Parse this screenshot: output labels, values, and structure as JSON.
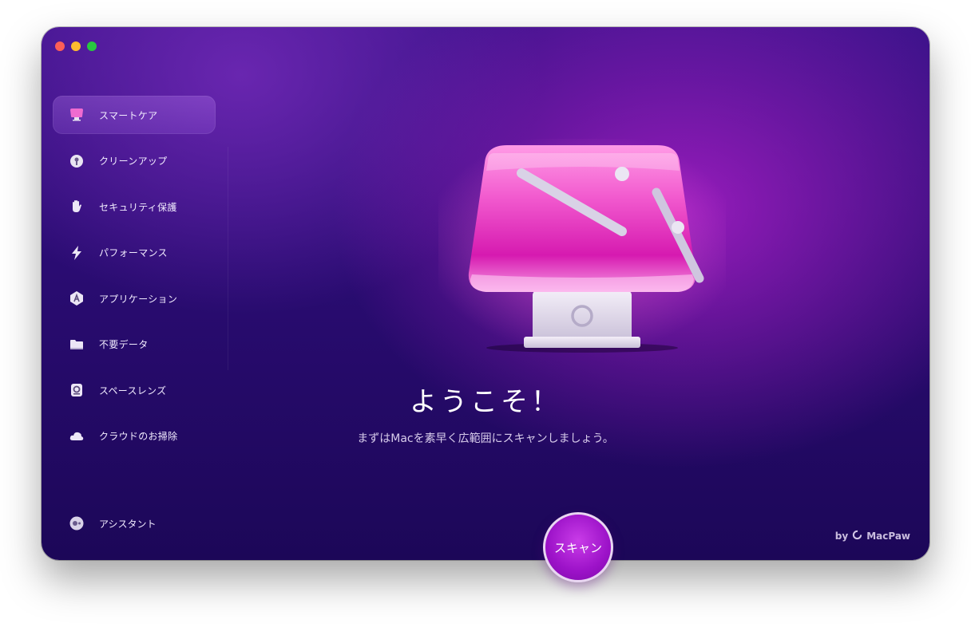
{
  "window": {
    "traffic_lights": [
      "close",
      "minimize",
      "maximize"
    ]
  },
  "sidebar": {
    "items": [
      {
        "label": "スマートケア",
        "icon": "monitor-icon",
        "active": true
      },
      {
        "label": "クリーンアップ",
        "icon": "cleanup-orb-icon",
        "active": false
      },
      {
        "label": "セキュリティ保護",
        "icon": "hand-icon",
        "active": false
      },
      {
        "label": "パフォーマンス",
        "icon": "lightning-icon",
        "active": false
      },
      {
        "label": "アプリケーション",
        "icon": "app-store-icon",
        "active": false
      },
      {
        "label": "不要データ",
        "icon": "folder-icon",
        "active": false
      },
      {
        "label": "スペースレンズ",
        "icon": "lens-icon",
        "active": false
      },
      {
        "label": "クラウドのお掃除",
        "icon": "cloud-icon",
        "active": false
      }
    ],
    "assistant_label": "アシスタント"
  },
  "main": {
    "title": "ようこそ！",
    "subtitle": "まずはMacを素早く広範囲にスキャンしましょう。",
    "scan_label": "スキャン",
    "brand_by": "by",
    "brand_name": "MacPaw"
  },
  "colors": {
    "accent": "#a418d0",
    "traffic_close": "#fe5f57",
    "traffic_min": "#febc2e",
    "traffic_max": "#28c840"
  }
}
